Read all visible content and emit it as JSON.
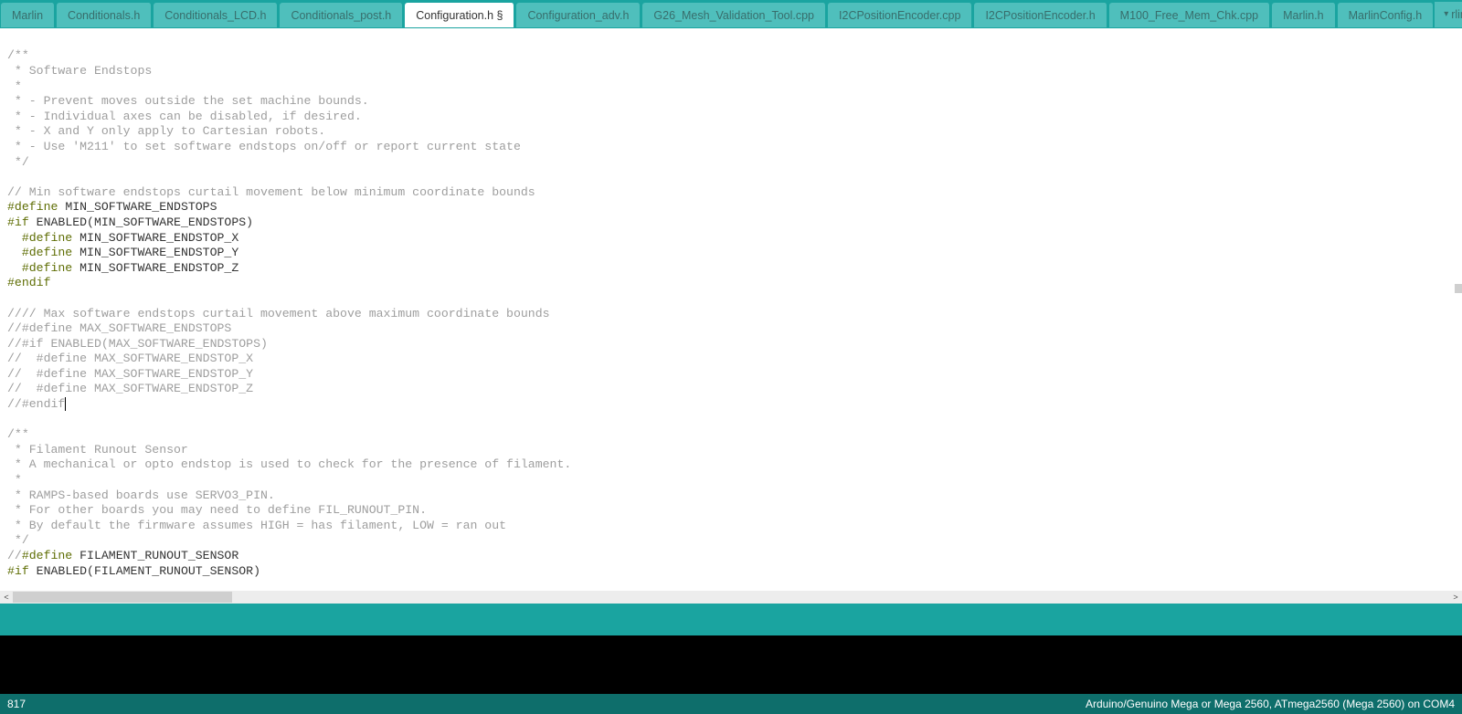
{
  "tabs": [
    {
      "label": "Marlin",
      "active": false
    },
    {
      "label": "Conditionals.h",
      "active": false
    },
    {
      "label": "Conditionals_LCD.h",
      "active": false
    },
    {
      "label": "Conditionals_post.h",
      "active": false
    },
    {
      "label": "Configuration.h §",
      "active": true
    },
    {
      "label": "Configuration_adv.h",
      "active": false
    },
    {
      "label": "G26_Mesh_Validation_Tool.cpp",
      "active": false
    },
    {
      "label": "I2CPositionEncoder.cpp",
      "active": false
    },
    {
      "label": "I2CPositionEncoder.h",
      "active": false
    },
    {
      "label": "M100_Free_Mem_Chk.cpp",
      "active": false
    },
    {
      "label": "Marlin.h",
      "active": false
    },
    {
      "label": "MarlinConfig.h",
      "active": false
    }
  ],
  "tab_overflow_label": "rlinS",
  "code": {
    "c1": "/**",
    "c2": " * Software Endstops",
    "c3": " *",
    "c4": " * - Prevent moves outside the set machine bounds.",
    "c5": " * - Individual axes can be disabled, if desired.",
    "c6": " * - X and Y only apply to Cartesian robots.",
    "c7": " * - Use 'M211' to set software endstops on/off or report current state",
    "c8": " */",
    "c9": "// Min software endstops curtail movement below minimum coordinate bounds",
    "d10a": "#define",
    "d10b": " MIN_SOFTWARE_ENDSTOPS",
    "d11a": "#if",
    "d11b": " ENABLED(MIN_SOFTWARE_ENDSTOPS)",
    "d12_indent": "  ",
    "d12a": "#define",
    "d12b": " MIN_SOFTWARE_ENDSTOP_X",
    "d13_indent": "  ",
    "d13a": "#define",
    "d13b": " MIN_SOFTWARE_ENDSTOP_Y",
    "d14_indent": "  ",
    "d14a": "#define",
    "d14b": " MIN_SOFTWARE_ENDSTOP_Z",
    "d15": "#endif",
    "c16": "//// Max software endstops curtail movement above maximum coordinate bounds",
    "c17": "//#define MAX_SOFTWARE_ENDSTOPS",
    "c18": "//#if ENABLED(MAX_SOFTWARE_ENDSTOPS)",
    "c19": "//  #define MAX_SOFTWARE_ENDSTOP_X",
    "c20": "//  #define MAX_SOFTWARE_ENDSTOP_Y",
    "c21": "//  #define MAX_SOFTWARE_ENDSTOP_Z",
    "c22": "//#endif",
    "c23": "/**",
    "c24": " * Filament Runout Sensor",
    "c25": " * A mechanical or opto endstop is used to check for the presence of filament.",
    "c26": " *",
    "c27": " * RAMPS-based boards use SERVO3_PIN.",
    "c28": " * For other boards you may need to define FIL_RUNOUT_PIN.",
    "c29": " * By default the firmware assumes HIGH = has filament, LOW = ran out",
    "c30": " */",
    "c31a": "//",
    "c31b": "#define",
    "c31c": " FILAMENT_RUNOUT_SENSOR",
    "d32a": "#if",
    "d32b": " ENABLED(FILAMENT_RUNOUT_SENSOR)"
  },
  "status": {
    "line_number": "817",
    "board_info": "Arduino/Genuino Mega or Mega 2560, ATmega2560 (Mega 2560) on COM4"
  }
}
